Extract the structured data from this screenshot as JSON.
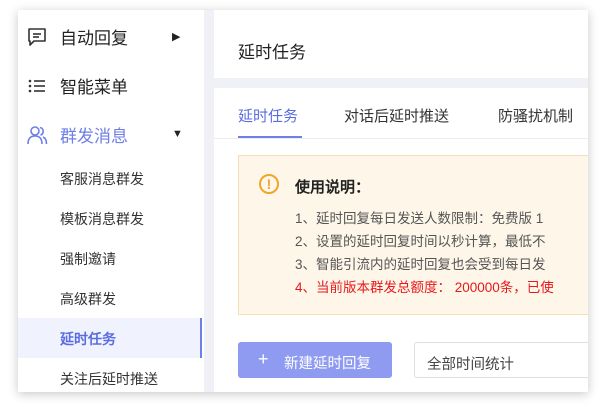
{
  "sidebar": {
    "auto_reply": "自动回复",
    "smart_menu": "智能菜单",
    "mass_message": "群发消息",
    "sub_items": [
      "客服消息群发",
      "模板消息群发",
      "强制邀请",
      "高级群发",
      "延时任务",
      "关注后延时推送"
    ]
  },
  "header": {
    "title": "延时任务"
  },
  "tabs": [
    "延时任务",
    "对话后延时推送",
    "防骚扰机制"
  ],
  "notice": {
    "title": "使用说明：",
    "lines": [
      "1、延时回复每日发送人数限制：免费版 1",
      "2、设置的延时回复时间以秒计算，最低不",
      "3、智能引流内的延时回复也会受到每日发",
      "4、当前版本群发总额度： 200000条，已使"
    ]
  },
  "actions": {
    "new_button": "新建延时回复",
    "time_filter": "全部时间统计"
  },
  "colors": {
    "accent": "#6e7fe8",
    "warning": "#e8191c",
    "notice_bg": "#fdf6e9"
  }
}
